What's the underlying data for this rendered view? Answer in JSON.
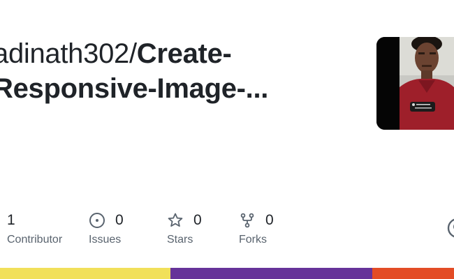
{
  "repo": {
    "owner": "adinath302/",
    "name_line1": "Create-",
    "name_line2": "Responsive-Image-...",
    "avatar_lines": [
      "@ adinath302",
      "New design"
    ]
  },
  "stats": [
    {
      "icon": "people-icon",
      "value": "1",
      "label": "Contributor"
    },
    {
      "icon": "issue-icon",
      "value": "0",
      "label": "Issues"
    },
    {
      "icon": "star-icon",
      "value": "0",
      "label": "Stars"
    },
    {
      "icon": "fork-icon",
      "value": "0",
      "label": "Forks"
    }
  ],
  "languages": [
    {
      "color": "#f1e05a",
      "share": 37.5
    },
    {
      "color": "#663399",
      "share": 44.5
    },
    {
      "color": "#e34c26",
      "share": 18.0
    }
  ]
}
